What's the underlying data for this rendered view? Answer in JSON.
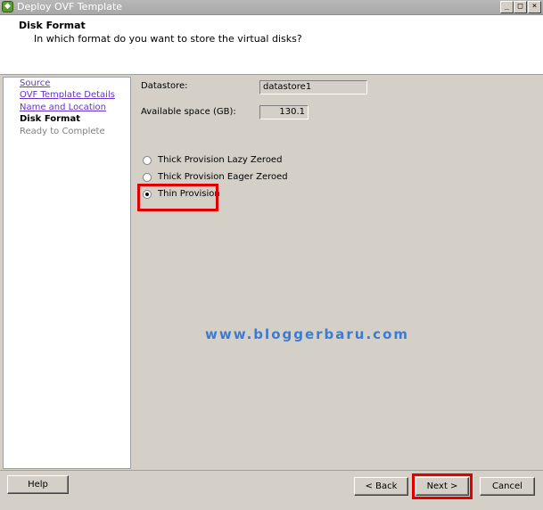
{
  "window": {
    "title": "Deploy OVF Template",
    "icon": "vm-deploy-icon",
    "controls": {
      "minimize": "_",
      "restore": "□",
      "close": "×"
    }
  },
  "header": {
    "title": "Disk Format",
    "subtitle": "In which format do you want to store the virtual disks?"
  },
  "sidebar": {
    "items": [
      {
        "label": "Source",
        "state": "link"
      },
      {
        "label": "OVF Template Details",
        "state": "link"
      },
      {
        "label": "Name and Location",
        "state": "link"
      },
      {
        "label": "Disk Format",
        "state": "current"
      },
      {
        "label": "Ready to Complete",
        "state": "pending"
      }
    ]
  },
  "content": {
    "datastore_label": "Datastore:",
    "datastore_value": "datastore1",
    "space_label": "Available space (GB):",
    "space_value": "130.1",
    "options": [
      {
        "label": "Thick Provision Lazy Zeroed",
        "checked": false
      },
      {
        "label": "Thick Provision Eager Zeroed",
        "checked": false
      },
      {
        "label": "Thin Provision",
        "checked": true
      }
    ],
    "watermark": "www.bloggerbaru.com"
  },
  "footer": {
    "help": "Help",
    "back": "< Back",
    "next": "Next >",
    "cancel": "Cancel"
  },
  "colors": {
    "highlight": "#e00000",
    "link": "#6633cc",
    "watermark": "#3a7bd5"
  }
}
